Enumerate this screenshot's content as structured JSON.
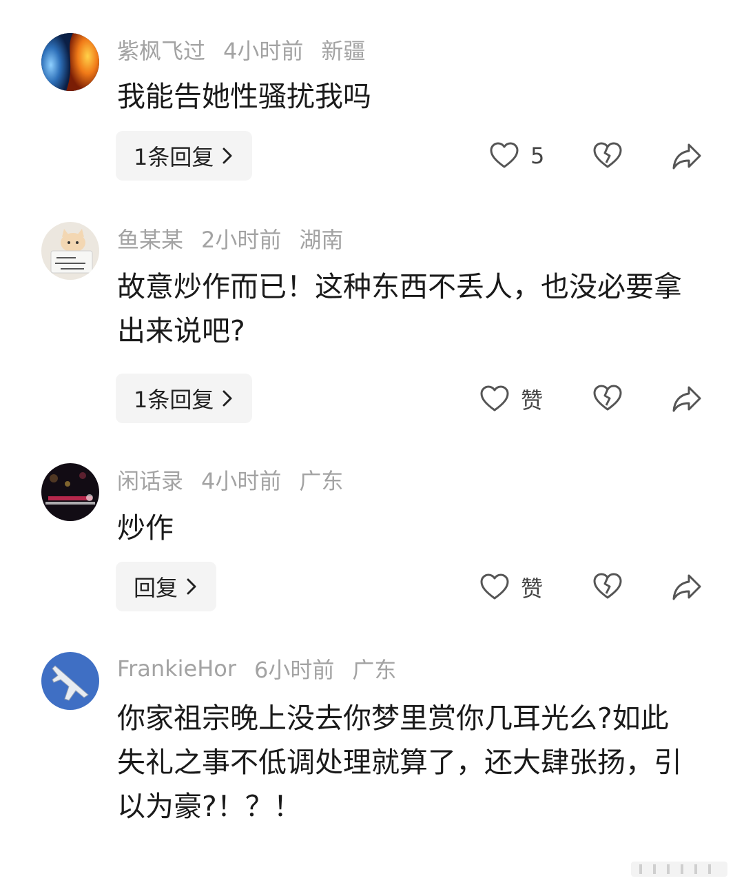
{
  "comments": [
    {
      "username": "紫枫飞过",
      "time": "4小时前",
      "location": "新疆",
      "text": "我能告她性骚扰我吗",
      "reply_label": "1条回复",
      "like_label": "5",
      "avatar": "fire-water-icon"
    },
    {
      "username": "鱼某某",
      "time": "2小时前",
      "location": "湖南",
      "text": "故意炒作而已！这种东西不丢人，也没必要拿出来说吧?",
      "reply_label": "1条回复",
      "like_label": "赞",
      "avatar": "cat-with-sign-icon"
    },
    {
      "username": "闲话录",
      "time": "4小时前",
      "location": "广东",
      "text": "炒作",
      "reply_label": "回复",
      "like_label": "赞",
      "avatar": "night-city-icon"
    },
    {
      "username": "FrankieHor",
      "time": "6小时前",
      "location": "广东",
      "text": "你家祖宗晚上没去你梦里赏你几耳光么?如此失礼之事不低调处理就算了，还大肆张扬，引以为豪?！？！",
      "avatar": "fighter-jet-icon"
    }
  ],
  "colors": {
    "meta": "#a3a3a3",
    "text": "#1a1a1a",
    "reply_bg": "#f4f4f4",
    "icon": "#555555"
  }
}
